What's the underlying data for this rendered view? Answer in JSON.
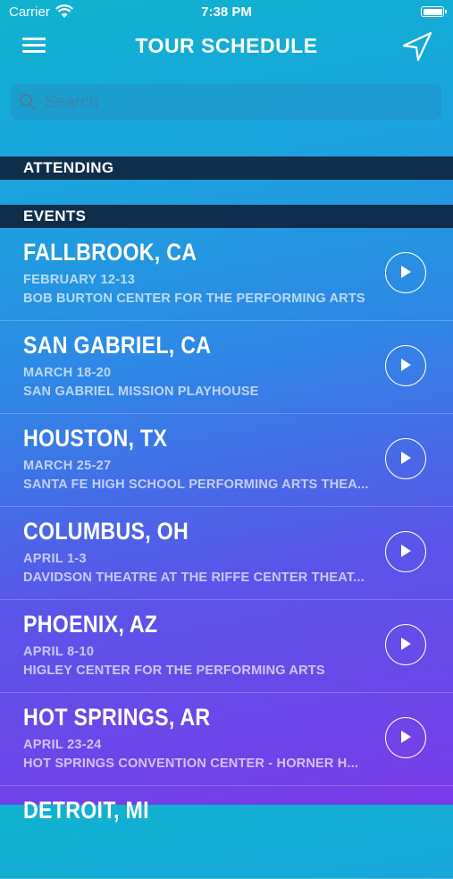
{
  "status_bar": {
    "carrier": "Carrier",
    "time": "7:38 PM"
  },
  "nav": {
    "title": "TOUR SCHEDULE"
  },
  "search": {
    "placeholder": "Search"
  },
  "sections": {
    "attending": "ATTENDING",
    "events": "EVENTS"
  },
  "events": [
    {
      "city": "FALLBROOK, CA",
      "dates": "FEBRUARY 12-13",
      "venue": "BOB BURTON CENTER FOR THE PERFORMING ARTS"
    },
    {
      "city": "SAN GABRIEL, CA",
      "dates": "MARCH 18-20",
      "venue": "SAN GABRIEL MISSION PLAYHOUSE"
    },
    {
      "city": "HOUSTON, TX",
      "dates": "MARCH 25-27",
      "venue": "SANTA FE HIGH SCHOOL PERFORMING ARTS THEA..."
    },
    {
      "city": "COLUMBUS, OH",
      "dates": "APRIL 1-3",
      "venue": "DAVIDSON THEATRE AT THE RIFFE CENTER THEAT..."
    },
    {
      "city": "PHOENIX, AZ",
      "dates": "APRIL 8-10",
      "venue": "HIGLEY CENTER FOR THE PERFORMING ARTS"
    },
    {
      "city": "HOT SPRINGS, AR",
      "dates": "APRIL 23-24",
      "venue": "HOT SPRINGS CONVENTION CENTER - HORNER H..."
    },
    {
      "city": "DETROIT, MI",
      "dates": "",
      "venue": ""
    }
  ],
  "icons": {
    "menu": "hamburger-menu-icon",
    "location": "location-arrow-icon",
    "search": "magnifier-icon",
    "play": "play-icon"
  }
}
